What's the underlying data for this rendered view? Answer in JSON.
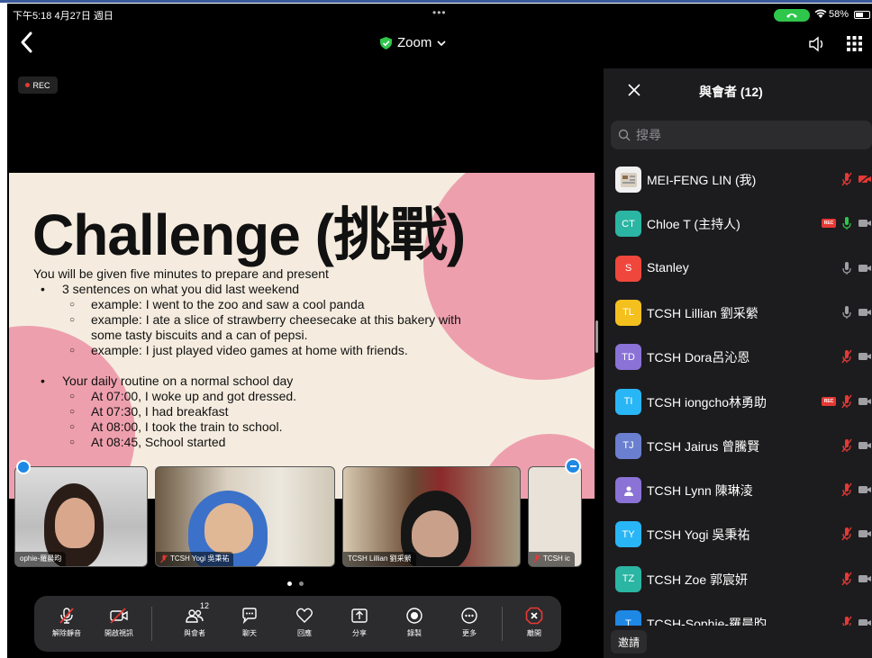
{
  "status_bar": {
    "time": "下午5:18  4月27日 週日",
    "dots": "•••",
    "battery": "58%",
    "battery_level": 0.58
  },
  "header": {
    "title": "Zoom",
    "title_chevron": "chevron-down-icon"
  },
  "rec_badge": "REC",
  "slide": {
    "title": "Challenge (挑戰)",
    "intro": "You will be given five minutes to prepare and present",
    "bullet1": "3 sentences on what you did last weekend",
    "sub1": "example: I went to the zoo and saw a cool panda",
    "sub2a": "example: I ate a slice of strawberry cheesecake at this bakery with",
    "sub2b": "some tasty biscuits and a can of pepsi.",
    "sub3": "example: I just played video games at home with friends.",
    "bullet2": "Your daily routine on a normal school day",
    "sub4": "At 07:00, I woke up and got dressed.",
    "sub5": "At 07:30, I had breakfast",
    "sub6": "At 08:00, I took the train to school.",
    "sub7": "At 08:45, School started"
  },
  "thumbnails": [
    {
      "label": "ophie-羅晨昀",
      "muted": false
    },
    {
      "label": "TCSH Yogi 吳秉祐",
      "muted": true
    },
    {
      "label": "TCSH Lillian 劉采縈",
      "muted": false
    },
    {
      "label": "TCSH ic",
      "muted": true
    }
  ],
  "page_indicator": {
    "count": 2,
    "active": 1
  },
  "toolbar": {
    "unmute": "解除靜音",
    "start_video": "開啟視訊",
    "participants": "與會者",
    "participants_count": "12",
    "chat": "聊天",
    "reactions": "回應",
    "share": "分享",
    "record": "錄製",
    "more": "更多",
    "leave": "離開"
  },
  "panel": {
    "title": "與會者 (12)",
    "search_placeholder": "搜尋",
    "invite": "邀請",
    "participants": [
      {
        "initials": "",
        "name": "MEI-FENG LIN (我)",
        "color": "#f0f0f0",
        "rec": false,
        "mic": "muted",
        "video": "off"
      },
      {
        "initials": "CT",
        "name": "Chloe T (主持人)",
        "color": "#2bb5a3",
        "rec": true,
        "mic": "active",
        "video": "on"
      },
      {
        "initials": "S",
        "name": "Stanley",
        "color": "#f0473c",
        "rec": false,
        "mic": "on",
        "video": "on"
      },
      {
        "initials": "TL",
        "name": "TCSH Lillian 劉采縈",
        "color": "#f4c01e",
        "rec": false,
        "mic": "on",
        "video": "on"
      },
      {
        "initials": "TD",
        "name": "TCSH Dora呂沁恩",
        "color": "#8a72d6",
        "rec": false,
        "mic": "muted",
        "video": "on"
      },
      {
        "initials": "TI",
        "name": "TCSH iongcho林勇助",
        "color": "#29b6f6",
        "rec": true,
        "mic": "muted",
        "video": "on"
      },
      {
        "initials": "TJ",
        "name": "TCSH Jairus 曾騰賢",
        "color": "#6a7fd0",
        "rec": false,
        "mic": "muted",
        "video": "on"
      },
      {
        "initials": "",
        "name": "TCSH Lynn 陳琳淩",
        "color": "#8a72d6",
        "rec": false,
        "mic": "muted",
        "video": "on"
      },
      {
        "initials": "TY",
        "name": "TCSH Yogi 吳秉祐",
        "color": "#29b6f6",
        "rec": false,
        "mic": "muted",
        "video": "on"
      },
      {
        "initials": "TZ",
        "name": "TCSH Zoe 郭宸妍",
        "color": "#2bb5a3",
        "rec": false,
        "mic": "muted",
        "video": "on"
      },
      {
        "initials": "T",
        "name": "TCSH-Sophie-羅晨昀",
        "color": "#1e88e5",
        "rec": false,
        "mic": "muted",
        "video": "on"
      }
    ]
  },
  "colors": {
    "accent_green": "#2fc64c",
    "mute_red": "#e53935",
    "slide_bg": "#f5ecdf",
    "slide_pink": "#ee9fad"
  }
}
